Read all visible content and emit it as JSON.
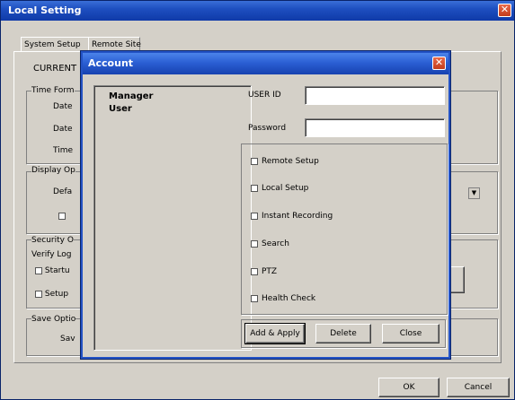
{
  "window": {
    "title": "Local Setting"
  },
  "tabs": [
    {
      "label": "System Setup"
    },
    {
      "label": "Remote Site"
    }
  ],
  "background": {
    "current_label": "CURRENT",
    "time_group": "Time Form",
    "date1": "Date",
    "date2": "Date",
    "time": "Time",
    "display_group": "Display Op",
    "default_label": "Defa",
    "security_group": "Security O",
    "verify_label": "Verify Log",
    "startup_label": "Startu",
    "setup_label": "Setup",
    "save_group": "Save Optio",
    "save_label": "Sav"
  },
  "footer": {
    "ok_label": "OK",
    "cancel_label": "Cancel"
  },
  "account_dialog": {
    "title": "Account",
    "users": [
      "Manager",
      "User"
    ],
    "user_id_label": "USER ID",
    "user_id_value": "",
    "password_label": "Password",
    "password_value": "",
    "permissions": [
      "Remote Setup",
      "Local Setup",
      "Instant Recording",
      "Search",
      "PTZ",
      "Health Check"
    ],
    "add_apply_label": "Add & Apply",
    "delete_label": "Delete",
    "close_label": "Close"
  },
  "colors": {
    "titlebar": "#1e4fc0",
    "dialog_face": "#d4d0c8",
    "close_red": "#c23c1c"
  }
}
